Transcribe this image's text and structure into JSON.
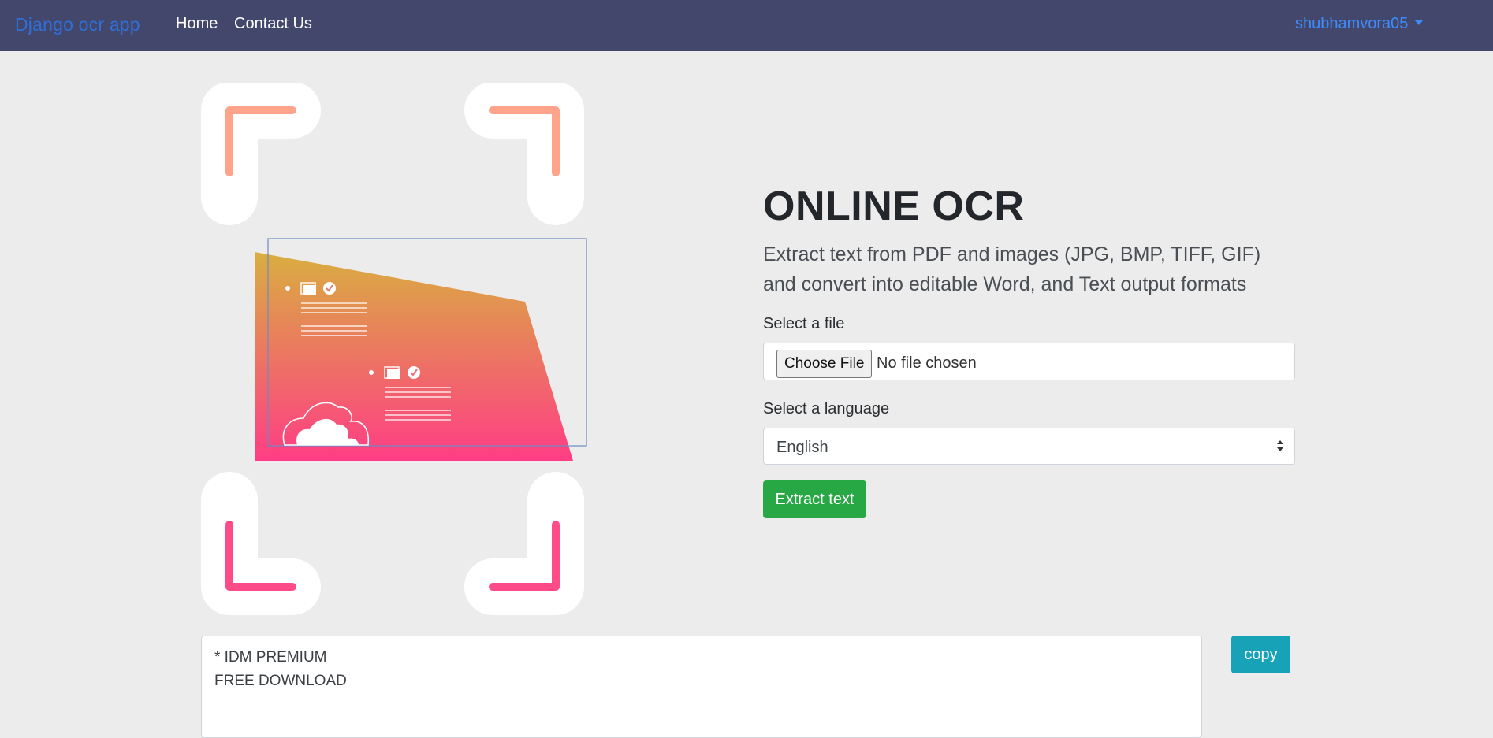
{
  "navbar": {
    "brand": "Django ocr app",
    "links": [
      {
        "label": "Home"
      },
      {
        "label": "Contact Us"
      }
    ],
    "user": "shubhamvora05"
  },
  "hero": {
    "title": "ONLINE OCR",
    "description": "Extract text from PDF and images (JPG, BMP, TIFF, GIF) and convert into editable Word, and Text output formats"
  },
  "form": {
    "file_label": "Select a file",
    "file_button": "Choose File",
    "file_status": "No file chosen",
    "language_label": "Select a language",
    "language_selected": "English",
    "submit_label": "Extract text"
  },
  "output": {
    "text": "* IDM PREMIUM\nFREE DOWNLOAD",
    "copy_label": "copy"
  },
  "colors": {
    "navbar_bg": "#43476b",
    "brand": "#2f6fd8",
    "user_link": "#3d8bfd",
    "extract_button": "#28a745",
    "copy_button": "#17a2b8",
    "corner_top": "#ffa48a",
    "corner_bottom": "#ff4b87",
    "gradient_top": "#d9ae40",
    "gradient_bottom": "#ff3d85"
  }
}
